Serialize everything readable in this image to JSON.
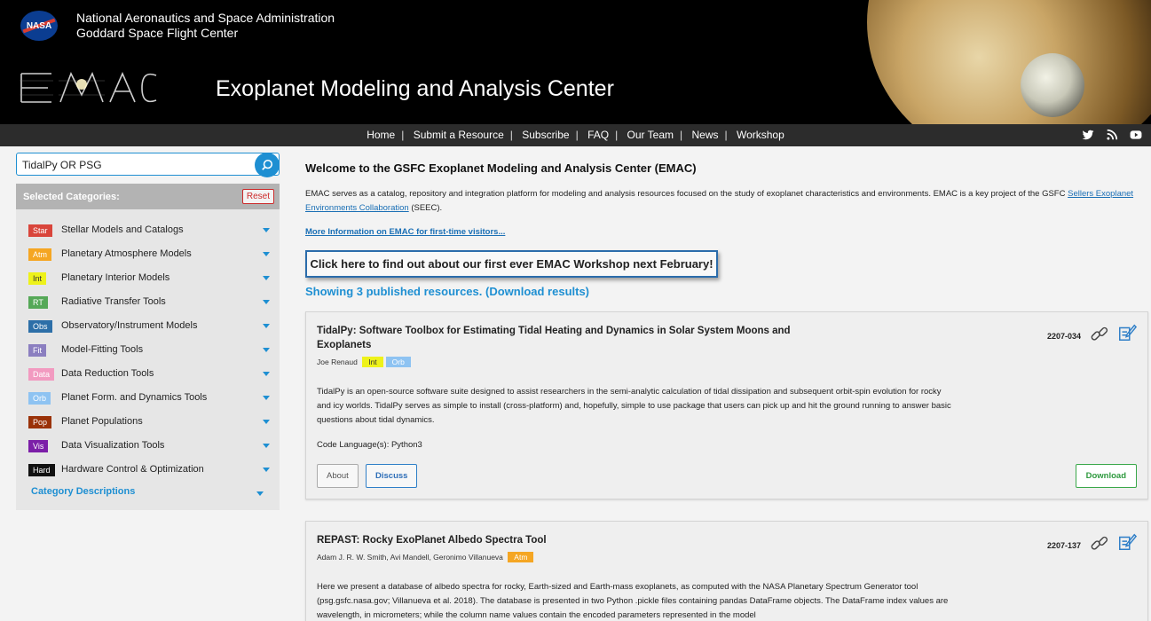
{
  "header": {
    "agency_line1": "National Aeronautics and Space Administration",
    "agency_line2": "Goddard Space Flight Center",
    "nasa_logo_text": "NASA",
    "title": "Exoplanet Modeling and Analysis Center"
  },
  "nav": {
    "items": [
      "Home",
      "Submit a Resource",
      "Subscribe",
      "FAQ",
      "Our Team",
      "News",
      "Workshop"
    ],
    "separator": "|"
  },
  "search": {
    "value": "TidalPy OR PSG"
  },
  "sidebar": {
    "header_label": "Selected Categories:",
    "reset_label": "Reset",
    "categories": [
      {
        "badge": "Star",
        "label": "Stellar Models and Catalogs",
        "color": "#d9453b",
        "text": "#ffffff"
      },
      {
        "badge": "Atm",
        "label": "Planetary Atmosphere Models",
        "color": "#f5a623",
        "text": "#ffffff"
      },
      {
        "badge": "Int",
        "label": "Planetary Interior Models",
        "color": "#eef21a",
        "text": "#333333"
      },
      {
        "badge": "RT",
        "label": "Radiative Transfer Tools",
        "color": "#55a857",
        "text": "#ffffff"
      },
      {
        "badge": "Obs",
        "label": "Observatory/Instrument Models",
        "color": "#2d6fa8",
        "text": "#ffffff"
      },
      {
        "badge": "Fit",
        "label": "Model-Fitting Tools",
        "color": "#8b7fc0",
        "text": "#ffffff"
      },
      {
        "badge": "Data",
        "label": "Data Reduction Tools",
        "color": "#f29ac0",
        "text": "#ffffff"
      },
      {
        "badge": "Orb",
        "label": "Planet Form. and Dynamics Tools",
        "color": "#8ec3f2",
        "text": "#ffffff"
      },
      {
        "badge": "Pop",
        "label": "Planet Populations",
        "color": "#9a3208",
        "text": "#ffffff"
      },
      {
        "badge": "Vis",
        "label": "Data Visualization Tools",
        "color": "#7c1fa8",
        "text": "#ffffff"
      },
      {
        "badge": "Hard",
        "label": "Hardware Control & Optimization",
        "color": "#111111",
        "text": "#ffffff"
      }
    ],
    "category_descriptions": "Category Descriptions"
  },
  "main": {
    "welcome": "Welcome to the GSFC Exoplanet Modeling and Analysis Center (EMAC)",
    "intro_before": "EMAC serves as a catalog, repository and integration platform for modeling and analysis resources focused on the study of exoplanet characteristics and environments. EMAC is a key project of the GSFC ",
    "intro_link": "Sellers Exoplanet Environments Collaboration",
    "intro_after": " (SEEC).",
    "more_info": "More Information on EMAC for first-time visitors...",
    "workshop_button": "Click here to find out about our first ever EMAC Workshop next February!",
    "showing": "Showing 3 published resources.",
    "download_results": "(Download results)"
  },
  "resources": [
    {
      "title": "TidalPy: Software Toolbox for Estimating Tidal Heating and Dynamics in Solar System Moons and Exoplanets",
      "authors": "Joe Renaud",
      "tags": [
        {
          "label": "Int",
          "color": "#eef21a",
          "text": "#333333"
        },
        {
          "label": "Orb",
          "color": "#8ec3f2",
          "text": "#ffffff"
        }
      ],
      "id": "2207-034",
      "description": "TidalPy is an open-source software suite designed to assist researchers in the semi-analytic calculation of tidal dissipation and subsequent orbit-spin evolution for rocky and icy worlds. TidalPy serves as simple to install (cross-platform) and, hopefully, simple to use package that users can pick up and hit the ground running to answer basic questions about tidal dynamics.",
      "language": "Code Language(s): Python3",
      "about": "About",
      "discuss": "Discuss",
      "download": "Download"
    },
    {
      "title": "REPAST: Rocky ExoPlanet Albedo Spectra Tool",
      "authors": "Adam J. R. W. Smith, Avi Mandell, Geronimo Villanueva",
      "tags": [
        {
          "label": "Atm",
          "color": "#f5a623",
          "text": "#ffffff"
        }
      ],
      "id": "2207-137",
      "description": "Here we present a database of albedo spectra for rocky, Earth-sized and Earth-mass exoplanets, as computed with the NASA Planetary Spectrum Generator tool (psg.gsfc.nasa.gov; Villanueva et al. 2018). The database is presented in two Python .pickle files containing pandas DataFrame objects. The DataFrame index values are wavelength, in micrometers; while the column name values contain the encoded parameters represented in the model"
    }
  ]
}
